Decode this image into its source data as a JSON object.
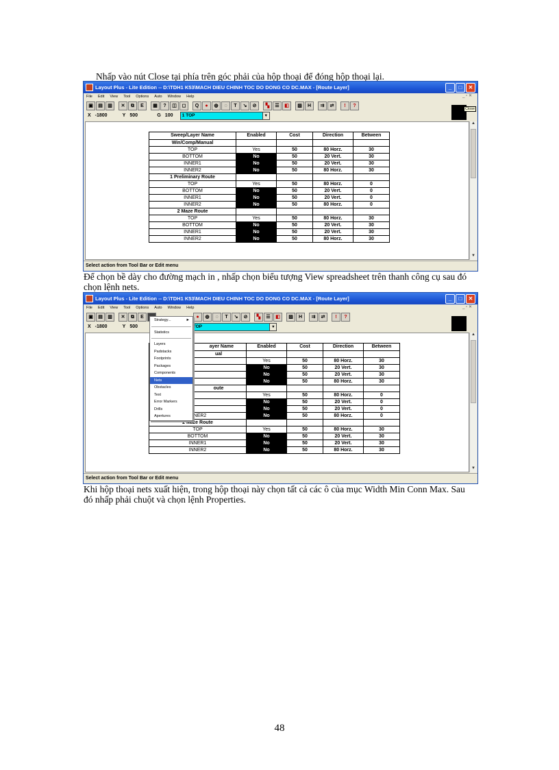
{
  "page": {
    "para1": "Nhấp vào nút Close tại phía trên góc phải của hộp thoại để đóng hộp thoại lại.",
    "para2": "Để chọn bề dày cho đường   mạch in , nhấp chọn biểu tượng   View spreadsheet trên thanh công cụ sau đó chọn lệnh nets.",
    "para3": "Khi hộp thoại nets xuất hiện, trong hộp thoại này chọn tất cả các ô của mục Width Min Conn Max. Sau đó nhấp phải chuột và chọn lệnh Properties.",
    "page_number": "48"
  },
  "window": {
    "title": "Layout Plus - Lite Edition -- D:\\TDH1 K53\\MACH DIEU CHINH TOC DO DONG CO DC.MAX - [Route Layer]",
    "menus": [
      "File",
      "Edit",
      "View",
      "Tool",
      "Options",
      "Auto",
      "Window",
      "Help"
    ],
    "menu_right": "_ ▫ ✕",
    "x_label": "X",
    "x_value": "-1800",
    "y_label": "Y",
    "y_value": "500",
    "g_label": "G",
    "g_value": "100",
    "layer_value": "1  TOP",
    "close_tooltip": "Close",
    "status_text": "Select action from Tool Bar or Edit menu"
  },
  "table": {
    "headers": [
      "Sweep/Layer Name",
      "Enabled",
      "Cost",
      "Direction",
      "Between"
    ],
    "groups": [
      {
        "name": "Win/Comp/Manual",
        "rows": [
          {
            "layer": "TOP",
            "enabled": "Yes",
            "cost": "50",
            "direction": "80 Horz.",
            "between": "30"
          },
          {
            "layer": "BOTTOM",
            "enabled": "No",
            "cost": "50",
            "direction": "20 Vert.",
            "between": "30"
          },
          {
            "layer": "INNER1",
            "enabled": "No",
            "cost": "50",
            "direction": "20 Vert.",
            "between": "30"
          },
          {
            "layer": "INNER2",
            "enabled": "No",
            "cost": "50",
            "direction": "80 Horz.",
            "between": "30"
          }
        ]
      },
      {
        "name": "1 Preliminary Route",
        "rows": [
          {
            "layer": "TOP",
            "enabled": "Yes",
            "cost": "50",
            "direction": "80 Horz.",
            "between": "0"
          },
          {
            "layer": "BOTTOM",
            "enabled": "No",
            "cost": "50",
            "direction": "20 Vert.",
            "between": "0"
          },
          {
            "layer": "INNER1",
            "enabled": "No",
            "cost": "50",
            "direction": "20 Vert.",
            "between": "0"
          },
          {
            "layer": "INNER2",
            "enabled": "No",
            "cost": "50",
            "direction": "80 Horz.",
            "between": "0"
          }
        ]
      },
      {
        "name": "2 Maze Route",
        "rows": [
          {
            "layer": "TOP",
            "enabled": "Yes",
            "cost": "50",
            "direction": "80 Horz.",
            "between": "30"
          },
          {
            "layer": "BOTTOM",
            "enabled": "No",
            "cost": "50",
            "direction": "20 Vert.",
            "between": "30"
          },
          {
            "layer": "INNER1",
            "enabled": "No",
            "cost": "50",
            "direction": "20 Vert.",
            "between": "30"
          },
          {
            "layer": "INNER2",
            "enabled": "No",
            "cost": "50",
            "direction": "80 Horz.",
            "between": "30"
          }
        ]
      }
    ]
  },
  "table2_partial": {
    "header_name": "ayer Name",
    "group1_name": "ual",
    "group2_name": "oute",
    "inner2_label": "INNER2"
  },
  "dropdown": {
    "items": [
      "Strategy...",
      "Statistics",
      "Layers",
      "Padstacks",
      "Footprints",
      "Packages",
      "Components",
      "Nets",
      "Obstacles",
      "Text",
      "Error Markers",
      "Drills",
      "Apertures"
    ],
    "selected": "Nets",
    "strategy_arrow": "►"
  },
  "icons": {
    "toolbar": [
      "open-icon",
      "save-icon",
      "print-icon",
      "cut-icon",
      "copy-icon",
      "paste-icon",
      "edit-icon",
      "spreadsheet-icon",
      "query-icon",
      "component-icon",
      "pin-icon",
      "zoom-icon",
      "text-icon",
      "obstacle-icon",
      "color-icon",
      "reconnect-icon",
      "route-icon",
      "help-icon"
    ]
  }
}
